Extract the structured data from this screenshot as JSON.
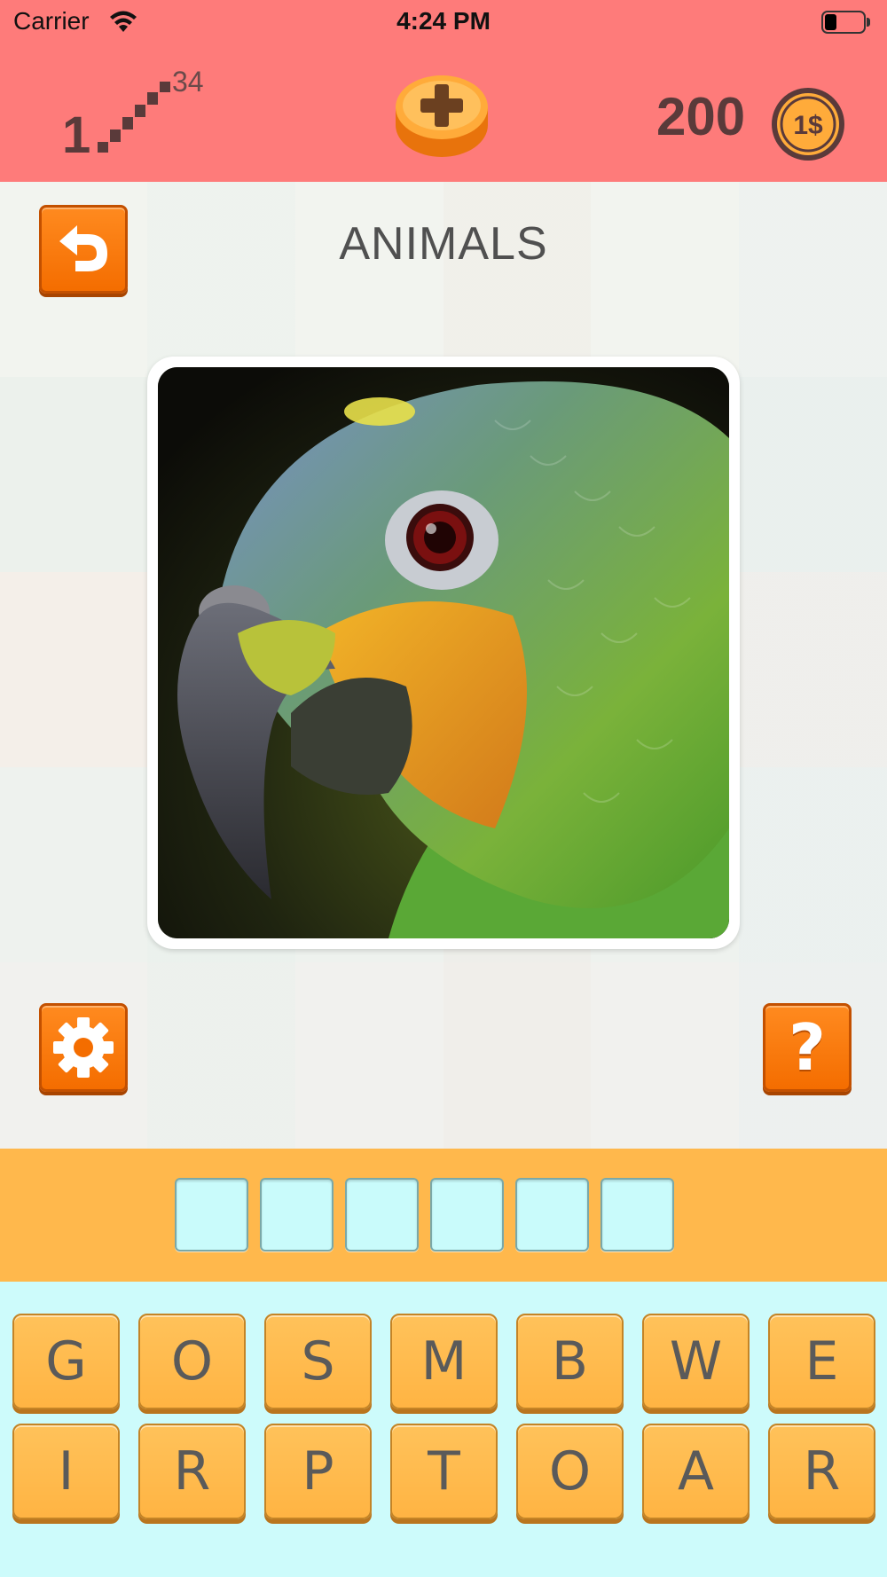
{
  "status_bar": {
    "carrier": "Carrier",
    "time": "4:24 PM",
    "battery_level": 0.3
  },
  "header": {
    "level": "1",
    "total_levels": "34",
    "coins": "200",
    "coin_label": "1$"
  },
  "category": "ANIMALS",
  "photo": {
    "subject": "parrot"
  },
  "answer": {
    "slot_count": 6
  },
  "keyboard": {
    "row1": [
      "G",
      "O",
      "S",
      "M",
      "B",
      "W",
      "E"
    ],
    "row2": [
      "I",
      "R",
      "P",
      "T",
      "O",
      "A",
      "R"
    ]
  },
  "colors": {
    "header_bg": "#fe7b7a",
    "button_orange": "#f46d00",
    "answer_strip": "#ffb84c",
    "keyboard_bg": "#cdfbfb",
    "slot_bg": "#c9fbfb"
  },
  "icons": {
    "back": "undo-arrow-icon",
    "settings": "gear-icon",
    "help": "question-mark-icon",
    "add_coins": "plus-coin-icon",
    "coin": "dollar-coin-icon",
    "level": "stairs-icon"
  }
}
